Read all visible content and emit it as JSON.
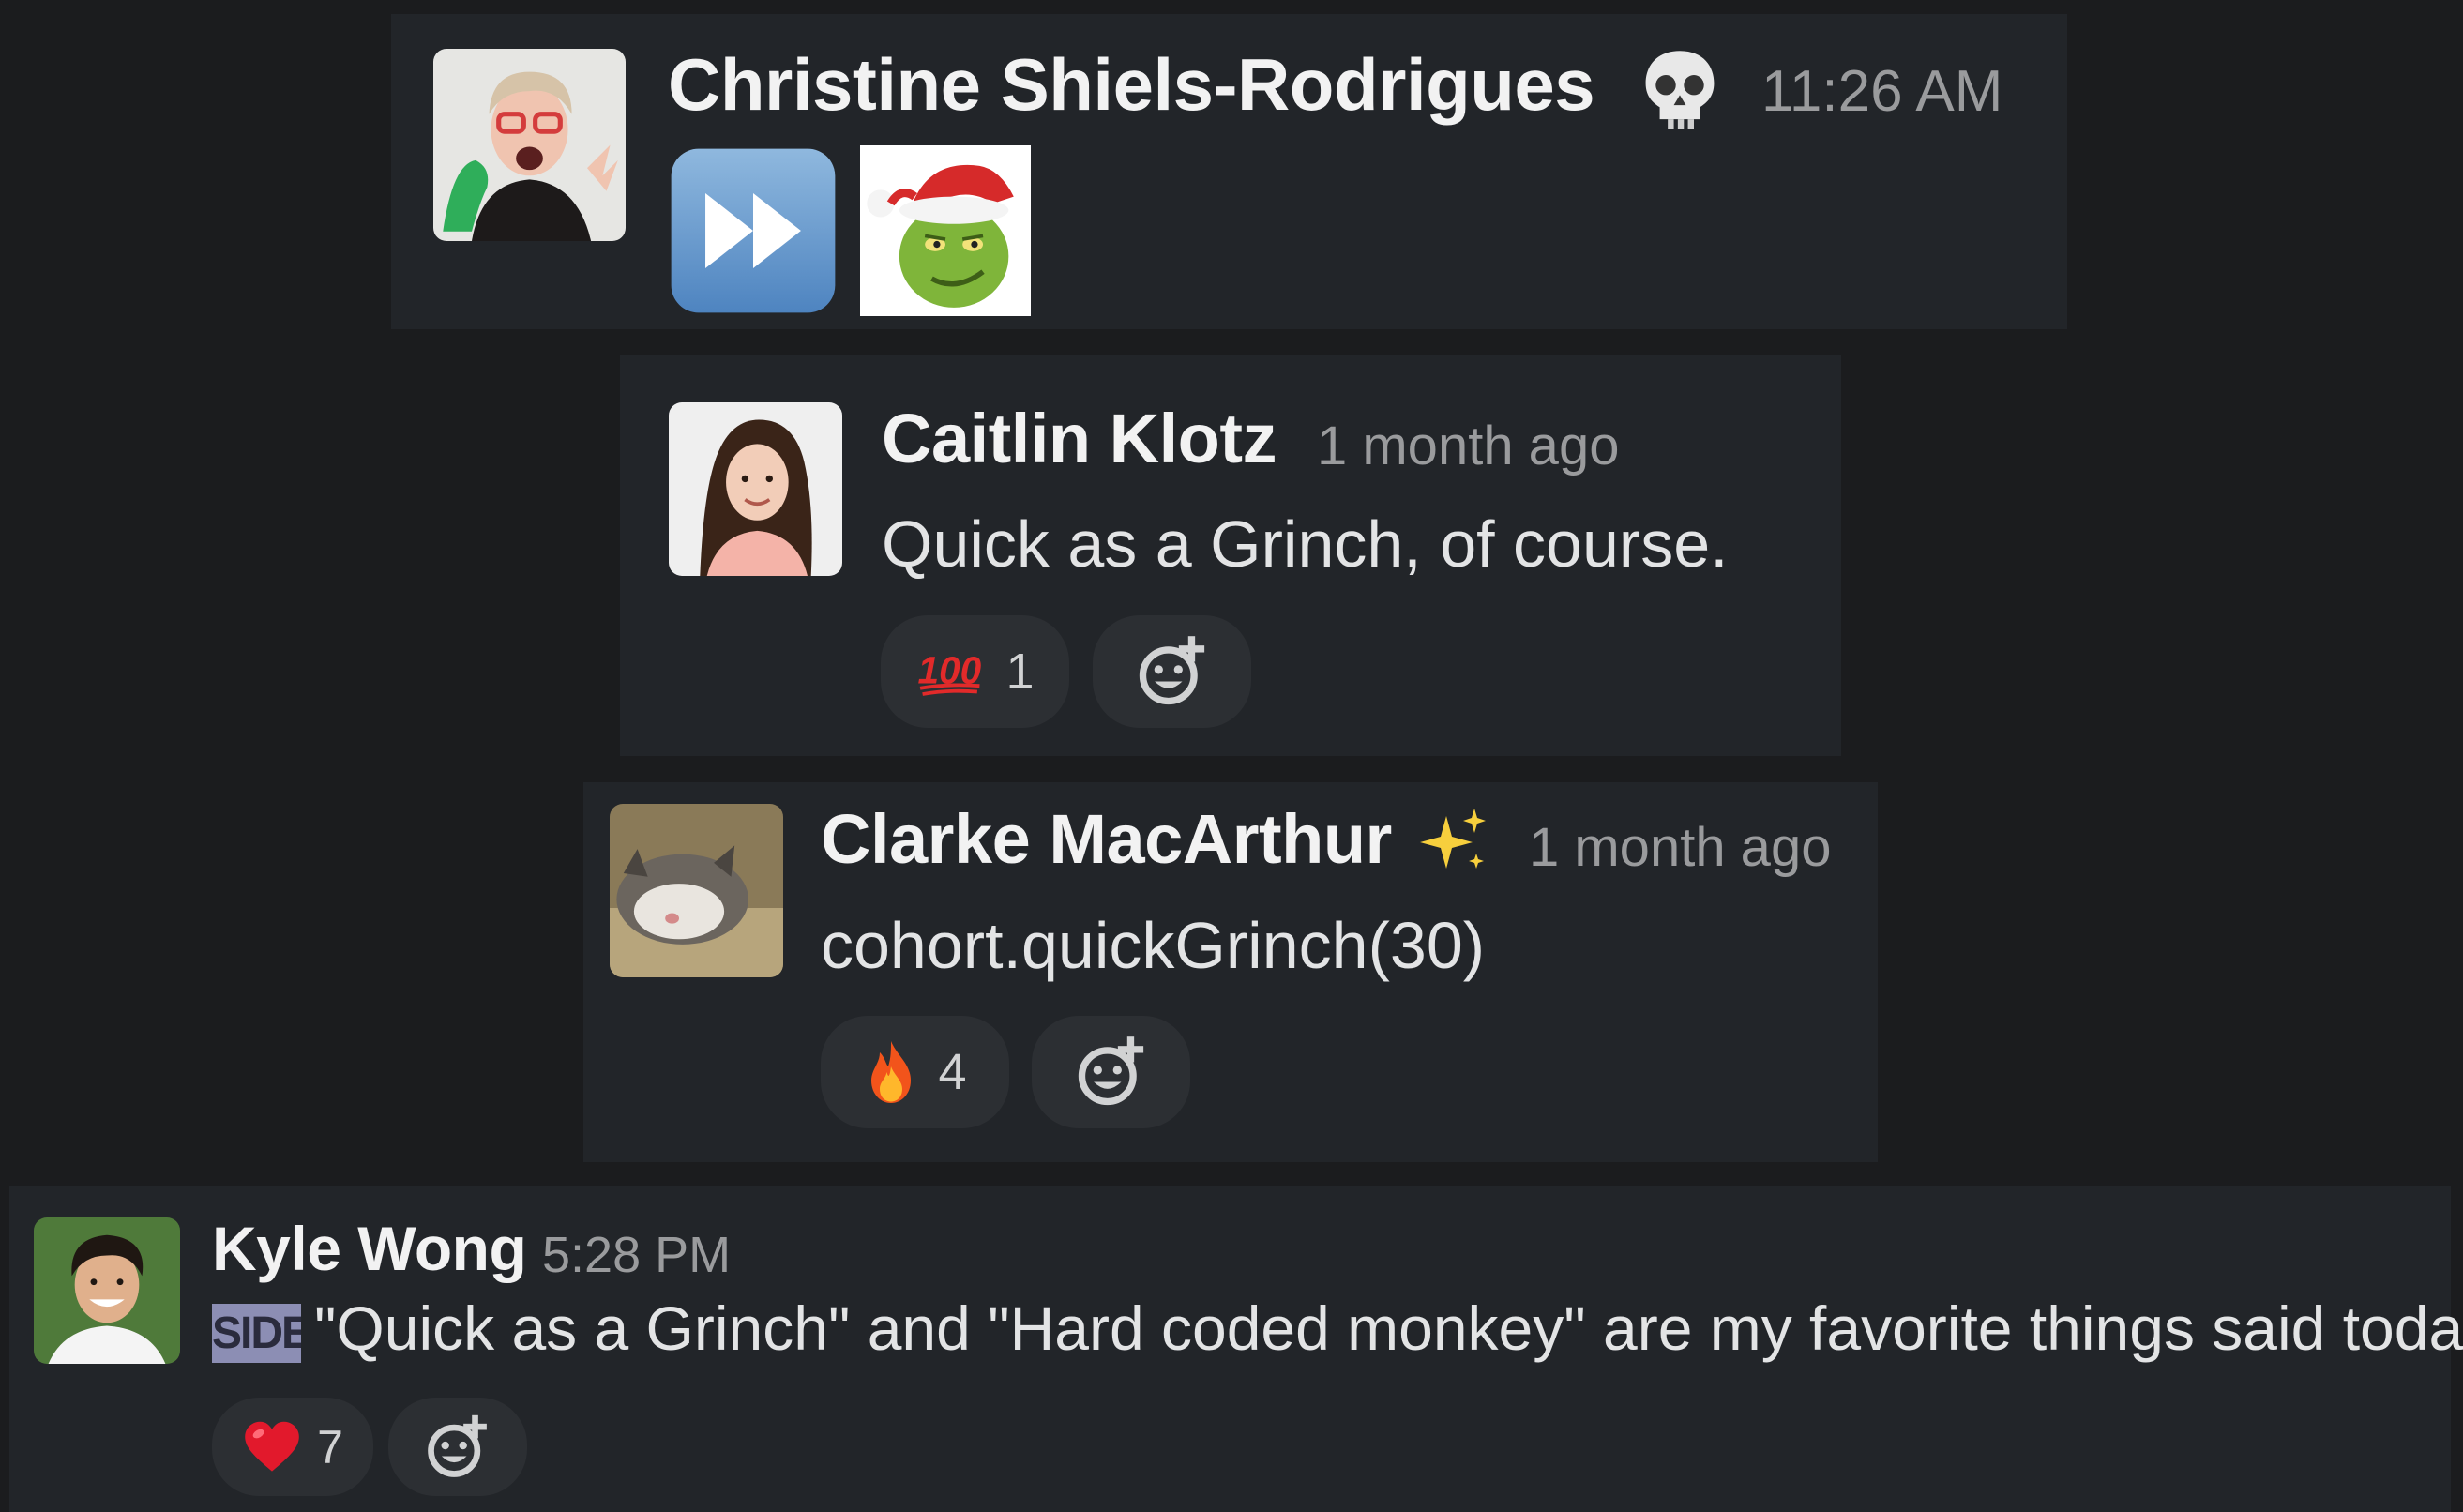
{
  "messages": [
    {
      "author": "Christine Shiels-Rodrigues",
      "status_emoji": "skull-icon",
      "time": "11:26 AM",
      "stickers": [
        "fast-forward-icon",
        "grinch-sticker"
      ]
    },
    {
      "author": "Caitlin Klotz",
      "time": "1 month ago",
      "text": "Quick as a Grinch, of course.",
      "reactions": [
        {
          "emoji": "hundred-points-icon",
          "count": "1"
        }
      ]
    },
    {
      "author": "Clarke MacArthur",
      "status_emoji": "sparkles-icon",
      "time": "1 month ago",
      "text": "cohort.quickGrinch(30)",
      "reactions": [
        {
          "emoji": "fire-icon",
          "count": "4"
        }
      ]
    },
    {
      "author": "Kyle Wong",
      "time": "5:28 PM",
      "tag": "SIDE",
      "text": "\"Quick as a Grinch\" and \"Hard coded monkey\" are my favorite things said today",
      "reactions": [
        {
          "emoji": "heart-icon",
          "count": "7"
        }
      ]
    }
  ],
  "colors": {
    "background": "#1b1c1e",
    "card": "#222529",
    "pill": "#2c2f33",
    "tag": "#8c8eb4"
  }
}
